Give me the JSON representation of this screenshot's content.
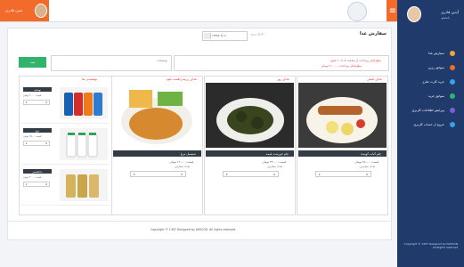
{
  "topbar": {
    "user_name": "ثمین قادری",
    "menu_icon": "hamburger-icon",
    "logo_icon": "university-seal-icon"
  },
  "sidebar": {
    "user_name": "آیدین قادری",
    "user_role": "دانشجو",
    "items": [
      {
        "label": "سفارش غذا",
        "icon": "food-icon",
        "color": "#f2a43a"
      },
      {
        "label": "سوابق رزرو",
        "icon": "history-icon",
        "color": "#f26b2a"
      },
      {
        "label": "خرید کارت شارژ",
        "icon": "card-icon",
        "color": "#39a3e4"
      },
      {
        "label": "سوابق خرید",
        "icon": "receipt-icon",
        "color": "#31b36b"
      },
      {
        "label": "ویرایش اطلاعات کاربری",
        "icon": "user-edit-icon",
        "color": "#7a62d6"
      },
      {
        "label": "خروج از حساب کاربری",
        "icon": "logout-icon",
        "color": "#39a3e4"
      }
    ],
    "footer": "Copyright © 1397 Designed by DAYCOD. All Rights reserved."
  },
  "main": {
    "title": "سفارش غذا",
    "date_value": "۱۳۹۷/۰۹/۰۶",
    "date_label": "تاریخ رزرو:",
    "notice_line1": "مبلغ قابل پرداخت از ساعت ۸ تا ۱۰ صبح",
    "notice_line2": "مبلغ قابل پرداخت: ۲۰۰۰۰ تومان",
    "notes_label": "توضیحات",
    "submit_label": "ثبت"
  },
  "cards": [
    {
      "category": "غذای اصلی",
      "name": "چلو کباب کوبیده",
      "price": "قیمت: ۲۵۰۰۰ تومان",
      "qty_label": "تعداد سفارش",
      "qty": "0"
    },
    {
      "category": "غذای روز",
      "name": "چلو خورشت قیمه",
      "price": "قیمت: ۲۳۰۰۰ تومان",
      "qty_label": "تعداد سفارش",
      "qty": "0"
    },
    {
      "category": "غذای رژیمی/فست فود",
      "name": "شنیسل مرغ",
      "price": "قیمت: ۱۹۰۰۰ تومان",
      "qty_label": "تعداد سفارش",
      "qty": "0"
    }
  ],
  "drinks": {
    "title": "نوشیدنی ها",
    "items": [
      {
        "name": "نوشابه",
        "price": "قیمت: ۳۰۰۰ تومان",
        "qty": "0"
      },
      {
        "name": "دوغ",
        "price": "قیمت: ۲۵۰۰ تومان",
        "qty": "0"
      },
      {
        "name": "ماءالشعیر",
        "price": "قیمت: ۴۰۰۰ تومان",
        "qty": "0"
      }
    ]
  },
  "footer": {
    "text": "Copyright © 1397 Designed by DAYCOD. All rights reserved."
  }
}
